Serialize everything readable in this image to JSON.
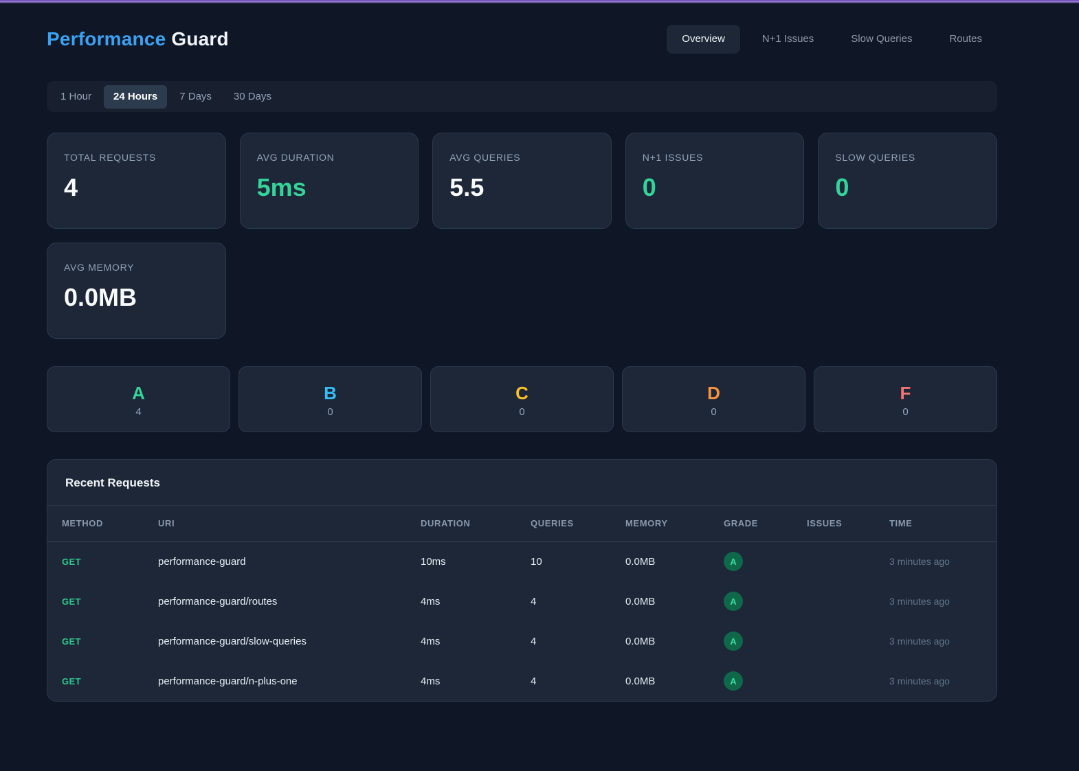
{
  "header": {
    "title_accent": "Performance",
    "title_rest": "Guard"
  },
  "nav": {
    "items": [
      {
        "label": "Overview",
        "active": true
      },
      {
        "label": "N+1 Issues",
        "active": false
      },
      {
        "label": "Slow Queries",
        "active": false
      },
      {
        "label": "Routes",
        "active": false
      }
    ]
  },
  "time_range": {
    "options": [
      {
        "label": "1 Hour",
        "active": false
      },
      {
        "label": "24 Hours",
        "active": true
      },
      {
        "label": "7 Days",
        "active": false
      },
      {
        "label": "30 Days",
        "active": false
      }
    ]
  },
  "stats": {
    "cards": [
      {
        "label": "TOTAL REQUESTS",
        "value": "4",
        "color": "white"
      },
      {
        "label": "AVG DURATION",
        "value": "5ms",
        "color": "green"
      },
      {
        "label": "AVG QUERIES",
        "value": "5.5",
        "color": "white"
      },
      {
        "label": "N+1 ISSUES",
        "value": "0",
        "color": "green"
      },
      {
        "label": "SLOW QUERIES",
        "value": "0",
        "color": "green"
      },
      {
        "label": "AVG MEMORY",
        "value": "0.0MB",
        "color": "white"
      }
    ]
  },
  "grades": {
    "items": [
      {
        "letter": "A",
        "count": "4",
        "color": "#34d399"
      },
      {
        "letter": "B",
        "count": "0",
        "color": "#38bdf8"
      },
      {
        "letter": "C",
        "count": "0",
        "color": "#fbbf24"
      },
      {
        "letter": "D",
        "count": "0",
        "color": "#fb923c"
      },
      {
        "letter": "F",
        "count": "0",
        "color": "#f87171"
      }
    ]
  },
  "table": {
    "title": "Recent Requests",
    "columns": [
      "METHOD",
      "URI",
      "DURATION",
      "QUERIES",
      "MEMORY",
      "GRADE",
      "ISSUES",
      "TIME"
    ],
    "rows": [
      {
        "method": "GET",
        "uri": "performance-guard",
        "duration": "10ms",
        "queries": "10",
        "memory": "0.0MB",
        "grade": "A",
        "issues": "",
        "time": "3 minutes ago"
      },
      {
        "method": "GET",
        "uri": "performance-guard/routes",
        "duration": "4ms",
        "queries": "4",
        "memory": "0.0MB",
        "grade": "A",
        "issues": "",
        "time": "3 minutes ago"
      },
      {
        "method": "GET",
        "uri": "performance-guard/slow-queries",
        "duration": "4ms",
        "queries": "4",
        "memory": "0.0MB",
        "grade": "A",
        "issues": "",
        "time": "3 minutes ago"
      },
      {
        "method": "GET",
        "uri": "performance-guard/n-plus-one",
        "duration": "4ms",
        "queries": "4",
        "memory": "0.0MB",
        "grade": "A",
        "issues": "",
        "time": "3 minutes ago"
      }
    ]
  }
}
